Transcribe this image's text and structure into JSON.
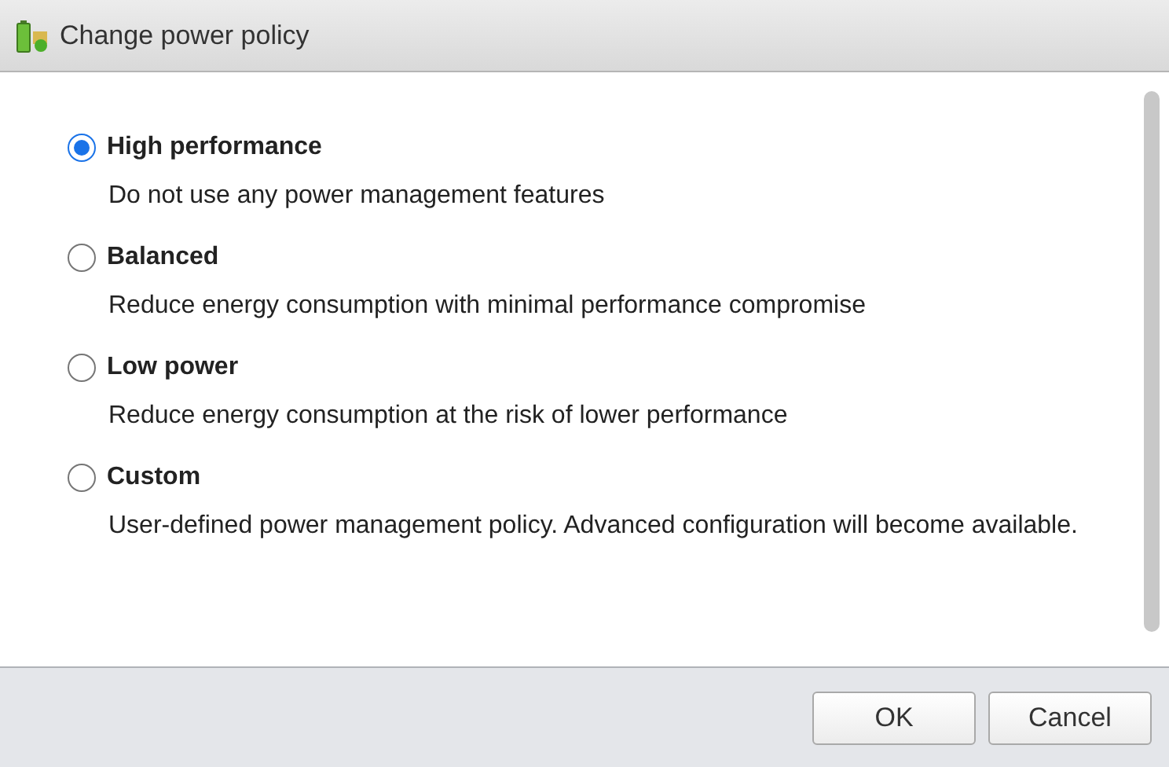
{
  "window": {
    "title": "Change power policy"
  },
  "options": [
    {
      "label": "High performance",
      "description": "Do not use any power management features",
      "selected": true
    },
    {
      "label": "Balanced",
      "description": "Reduce energy consumption with minimal performance compromise",
      "selected": false
    },
    {
      "label": "Low power",
      "description": "Reduce energy consumption at the risk of lower performance",
      "selected": false
    },
    {
      "label": "Custom",
      "description": "User-defined power management policy. Advanced configuration will become available.",
      "selected": false
    }
  ],
  "buttons": [
    "OK",
    "Cancel"
  ]
}
